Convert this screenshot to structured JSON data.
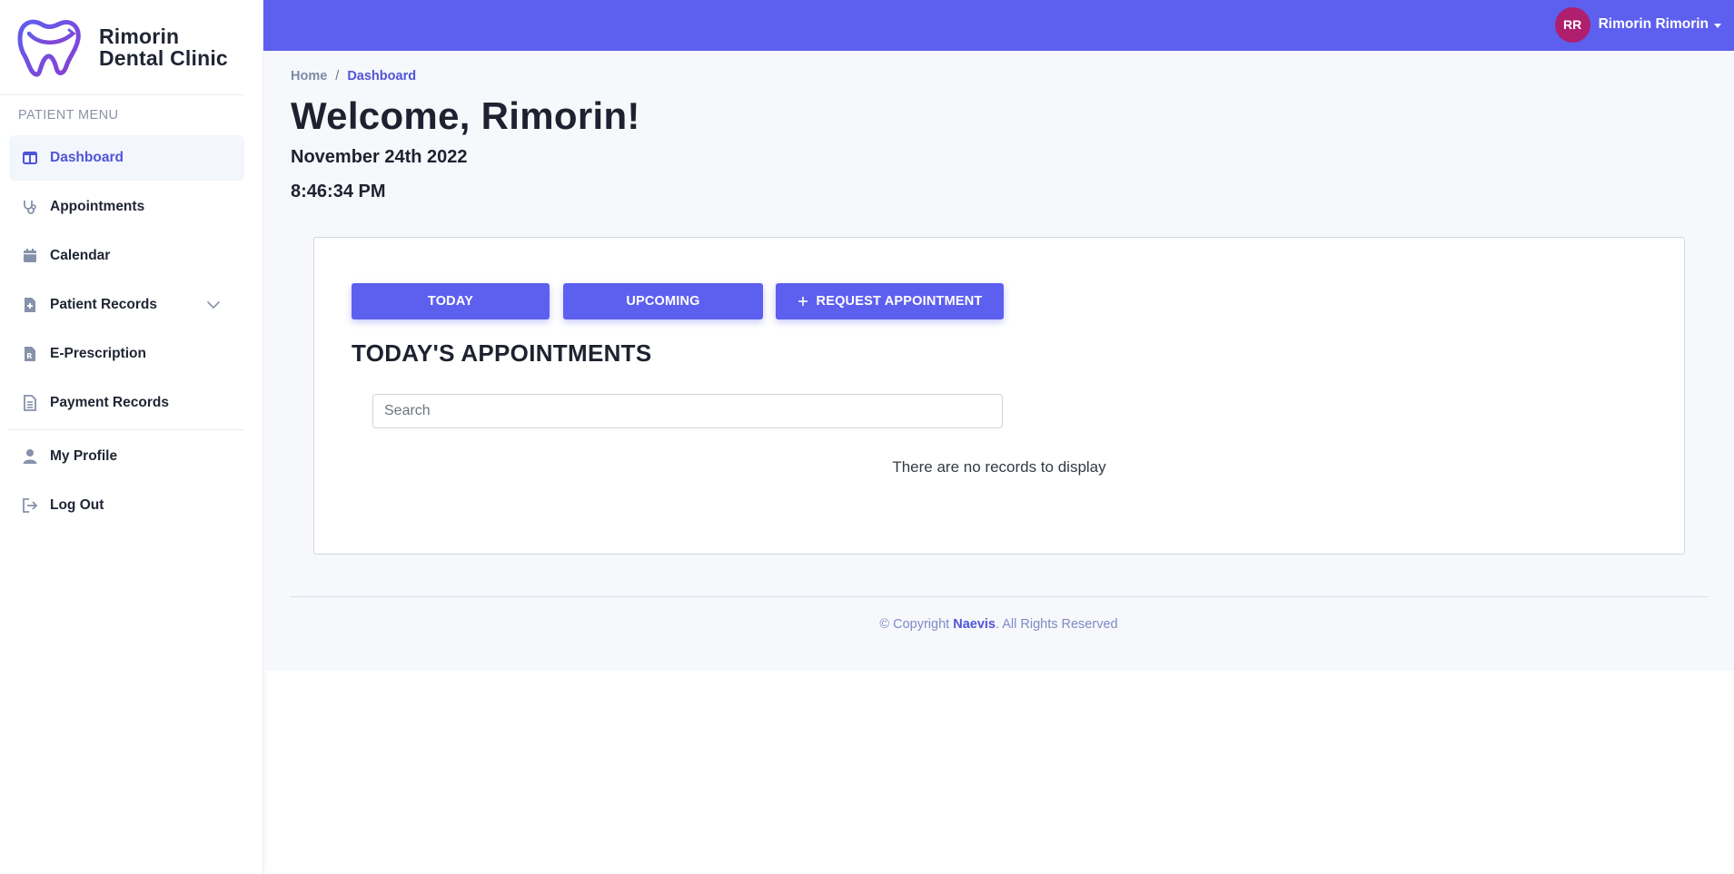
{
  "brand": {
    "name_line1": "Rimorin",
    "name_line2": "Dental Clinic",
    "logo_icon": "tooth-logo-icon"
  },
  "sidebar": {
    "heading": "PATIENT MENU",
    "items": [
      {
        "label": "Dashboard",
        "icon": "columns-icon",
        "active": true
      },
      {
        "label": "Appointments",
        "icon": "stethoscope-icon"
      },
      {
        "label": "Calendar",
        "icon": "calendar-icon"
      },
      {
        "label": "Patient Records",
        "icon": "file-medical-icon",
        "expandable": true
      },
      {
        "label": "E-Prescription",
        "icon": "prescription-icon"
      },
      {
        "label": "Payment Records",
        "icon": "document-icon"
      },
      {
        "label": "My Profile",
        "icon": "user-icon"
      },
      {
        "label": "Log Out",
        "icon": "logout-icon"
      }
    ]
  },
  "topbar": {
    "avatar_initials": "RR",
    "user_name": "Rimorin Rimorin"
  },
  "breadcrumb": {
    "home": "Home",
    "separator": "/",
    "current": "Dashboard"
  },
  "main": {
    "title": "Welcome, Rimorin!",
    "date": "November 24th 2022",
    "time": "8:46:34 PM"
  },
  "appointments": {
    "today_label": "TODAY",
    "upcoming_label": "UPCOMING",
    "request_label": "REQUEST APPOINTMENT",
    "section_title": "TODAY'S APPOINTMENTS",
    "search_placeholder": "Search",
    "empty_message": "There are no records to display"
  },
  "footer": {
    "prefix": "© Copyright ",
    "brand": "Naevis",
    "suffix": ". All Rights Reserved"
  },
  "colors": {
    "primary": "#5d5fef",
    "avatar": "#b01f6e",
    "active_text": "#4f55d8",
    "background": "#f6f8fb"
  }
}
